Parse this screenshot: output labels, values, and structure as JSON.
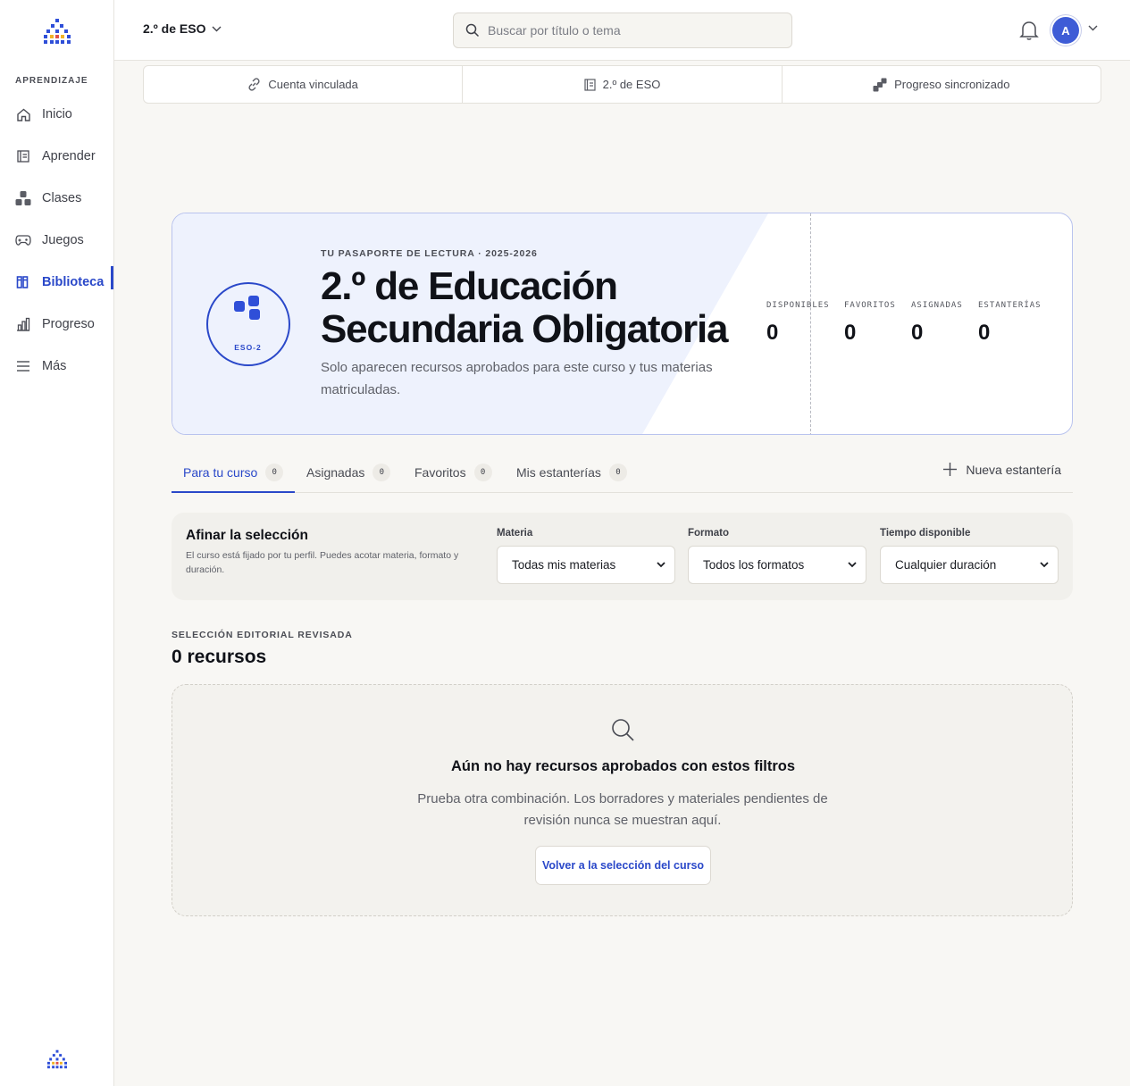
{
  "sidebar": {
    "section_label": "APRENDIZAJE",
    "items": [
      {
        "label": "Inicio",
        "icon": "home-icon"
      },
      {
        "label": "Aprender",
        "icon": "book-icon"
      },
      {
        "label": "Clases",
        "icon": "classes-icon"
      },
      {
        "label": "Juegos",
        "icon": "gamepad-icon"
      },
      {
        "label": "Biblioteca",
        "icon": "library-icon",
        "active": true
      },
      {
        "label": "Progreso",
        "icon": "bar-chart-icon"
      },
      {
        "label": "Más",
        "icon": "menu-icon"
      }
    ]
  },
  "topbar": {
    "course": "2.º de ESO",
    "search_placeholder": "Buscar por título o tema",
    "avatar_initial": "A"
  },
  "status_strip": [
    {
      "label": "Cuenta vinculada",
      "icon": "link-icon"
    },
    {
      "label": "2.º de ESO",
      "icon": "book-icon"
    },
    {
      "label": "Progreso sincronizado",
      "icon": "sync-steps-icon"
    }
  ],
  "passport": {
    "kicker": "TU PASAPORTE DE LECTURA · 2025-2026",
    "title_line1": "2.º de Educación",
    "title_line2": "Secundaria Obligatoria",
    "description": "Solo aparecen recursos aprobados para este curso y tus materias matriculadas.",
    "badge_code": "ESO-2",
    "stats": [
      {
        "label": "DISPONIBLES",
        "value": "0"
      },
      {
        "label": "FAVORITOS",
        "value": "0"
      },
      {
        "label": "ASIGNADAS",
        "value": "0"
      },
      {
        "label": "ESTANTERÍAS",
        "value": "0"
      }
    ]
  },
  "tabs": [
    {
      "label": "Para tu curso",
      "count": "0",
      "active": true
    },
    {
      "label": "Asignadas",
      "count": "0"
    },
    {
      "label": "Favoritos",
      "count": "0"
    },
    {
      "label": "Mis estanterías",
      "count": "0"
    }
  ],
  "new_shelf_label": "Nueva estantería",
  "filters": {
    "title": "Afinar la selección",
    "help": "El curso está fijado por tu perfil. Puedes acotar materia, formato y duración.",
    "groups": [
      {
        "label": "Materia",
        "value": "Todas mis materias"
      },
      {
        "label": "Formato",
        "value": "Todos los formatos"
      },
      {
        "label": "Tiempo disponible",
        "value": "Cualquier duración"
      }
    ]
  },
  "results": {
    "kicker": "SELECCIÓN EDITORIAL REVISADA",
    "count": "0 recursos",
    "empty_title": "Aún no hay recursos aprobados con estos filtros",
    "empty_text": "Prueba otra combinación. Los borradores y materiales pendientes de revisión nunca se muestran aquí.",
    "empty_button": "Volver a la selección del curso"
  },
  "colors": {
    "accent": "#2a48c9",
    "background": "#f8f7f4",
    "card_tint": "#eef2fd"
  }
}
